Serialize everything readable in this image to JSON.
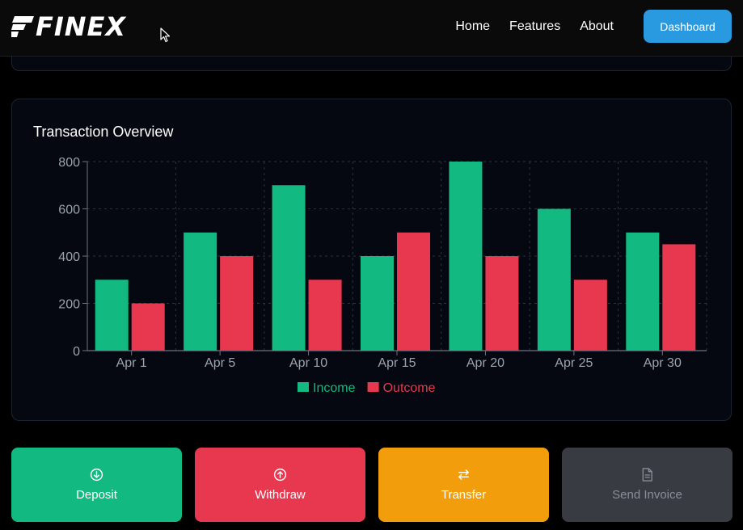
{
  "navbar": {
    "logo_text": "FINEX",
    "links": [
      "Home",
      "Features",
      "About"
    ],
    "dashboard_label": "Dashboard"
  },
  "chart_card": {
    "title": "Transaction Overview"
  },
  "chart_data": {
    "type": "bar",
    "title": "Transaction Overview",
    "categories": [
      "Apr 1",
      "Apr 5",
      "Apr 10",
      "Apr 15",
      "Apr 20",
      "Apr 25",
      "Apr 30"
    ],
    "series": [
      {
        "name": "Income",
        "color": "#12b981",
        "values": [
          300,
          500,
          700,
          400,
          800,
          600,
          500
        ]
      },
      {
        "name": "Outcome",
        "color": "#e8384f",
        "values": [
          200,
          400,
          300,
          500,
          400,
          300,
          450
        ]
      }
    ],
    "yticks": [
      0,
      200,
      400,
      600,
      800
    ],
    "ylim": [
      0,
      800
    ],
    "grid": true,
    "legend_position": "bottom"
  },
  "actions": {
    "deposit": {
      "label": "Deposit",
      "icon": "arrow-down-circle-icon",
      "color": "#12b981"
    },
    "withdraw": {
      "label": "Withdraw",
      "icon": "arrow-up-circle-icon",
      "color": "#e8384f"
    },
    "transfer": {
      "label": "Transfer",
      "icon": "swap-arrows-icon",
      "color": "#f29e0c"
    },
    "send_invoice": {
      "label": "Send Invoice",
      "icon": "document-icon",
      "color": "#383b42"
    }
  }
}
